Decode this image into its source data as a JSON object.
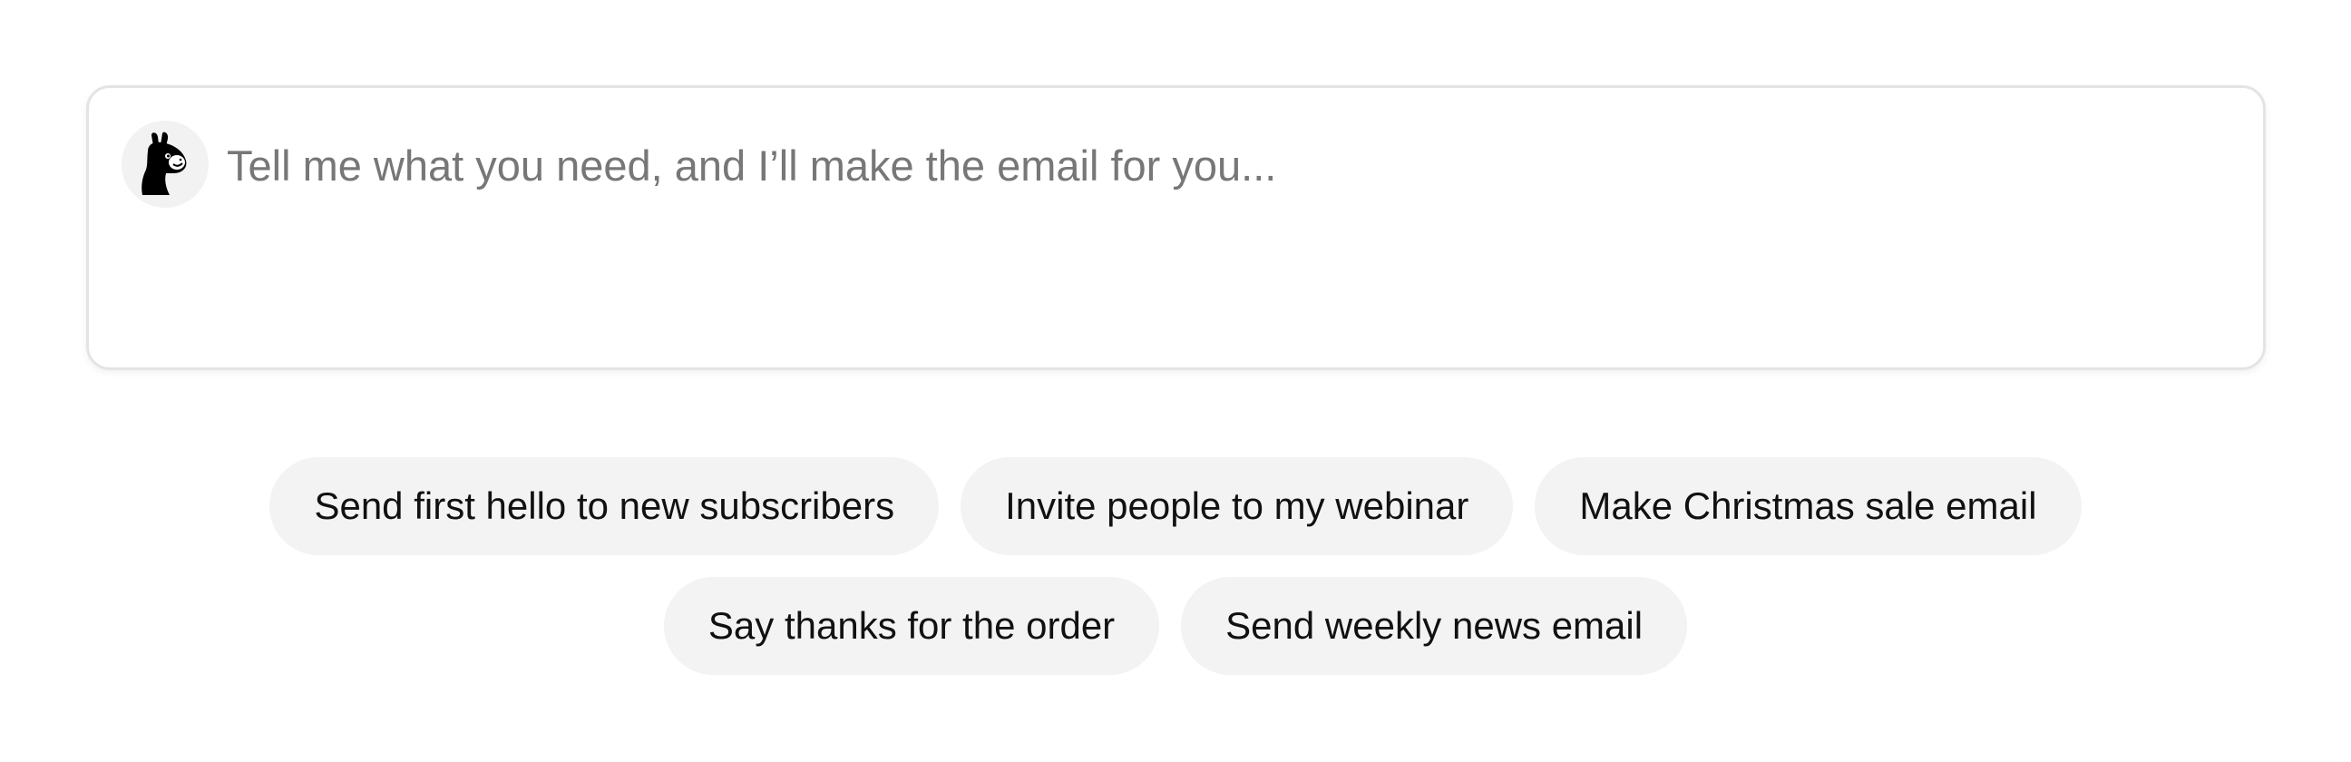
{
  "composer": {
    "placeholder": "Tell me what you need, and I’ll make the email for you...",
    "avatar_icon": "llama-icon"
  },
  "suggestions": {
    "row1": [
      {
        "label": "Send first hello to new subscribers"
      },
      {
        "label": "Invite people to my webinar"
      },
      {
        "label": "Make Christmas sale email"
      }
    ],
    "row2": [
      {
        "label": "Say thanks for the order"
      },
      {
        "label": "Send weekly news email"
      }
    ]
  },
  "colors": {
    "chip_background": "#f3f3f3",
    "border": "#e4e4e4",
    "placeholder_text": "#777777"
  }
}
